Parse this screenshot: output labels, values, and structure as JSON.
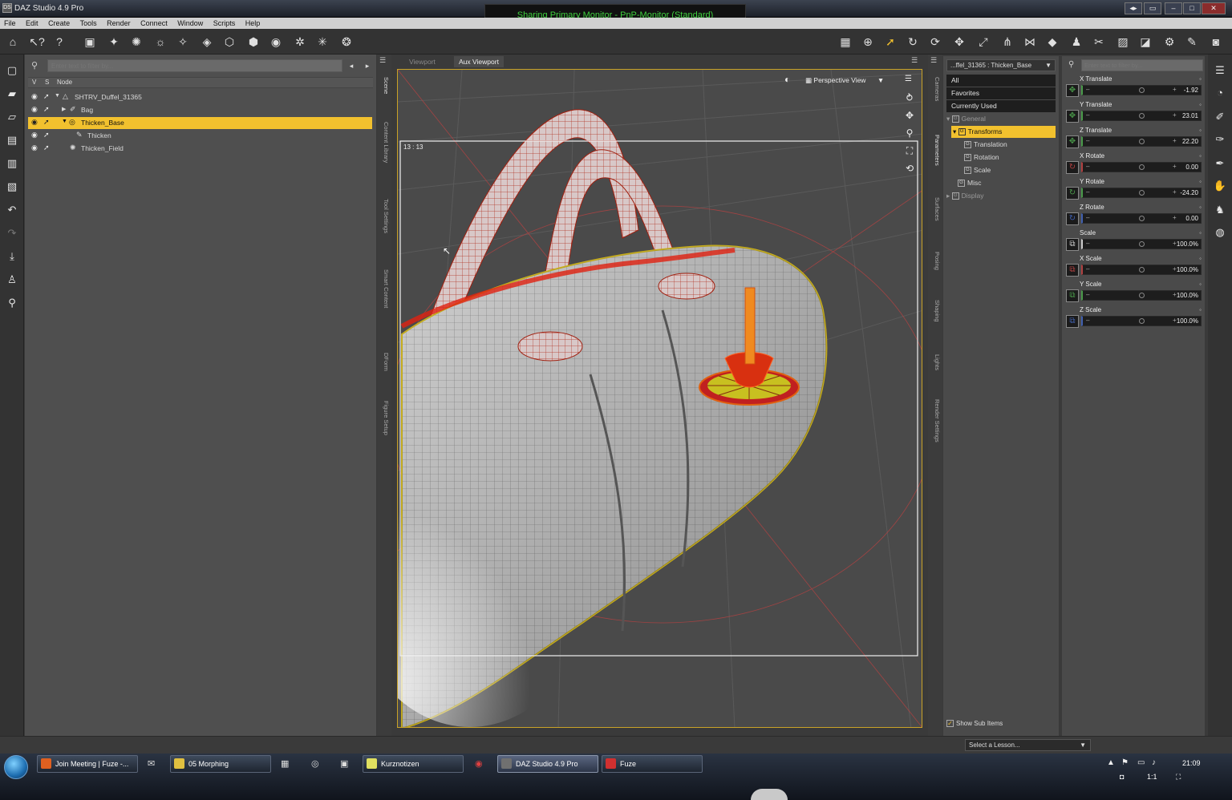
{
  "window": {
    "app_title": "DAZ Studio 4.9 Pro",
    "badge": "DS",
    "sharing_banner": "Sharing Primary Monitor - PnP-Monitor (Standard)"
  },
  "menu": [
    "File",
    "Edit",
    "Create",
    "Tools",
    "Render",
    "Connect",
    "Window",
    "Scripts",
    "Help"
  ],
  "scene": {
    "search_placeholder": "Enter text to filter by...",
    "col_v": "V",
    "col_s": "S",
    "col_node": "Node",
    "nodes": [
      {
        "name": "SHTRV_Duffel_31365"
      },
      {
        "name": "Bag"
      },
      {
        "name": "Thicken_Base"
      },
      {
        "name": "Thicken"
      },
      {
        "name": "Thicken_Field"
      }
    ]
  },
  "left_tabs": [
    "Scene",
    "Content Library",
    "Tool Settings",
    "Smart Content",
    "DForm",
    "Figure Setup"
  ],
  "viewport": {
    "tab1": "Viewport",
    "tab2": "Aux Viewport",
    "view_label": "Perspective View",
    "frame_label": "13 : 13"
  },
  "right_tabs": [
    "Cameras",
    "Parameters",
    "Surfaces",
    "Posing",
    "Shaping",
    "Lights",
    "Render Settings"
  ],
  "parameters": {
    "node_select": "...ffel_31365 : Thicken_Base",
    "search_placeholder": "Enter text to filter by...",
    "tree": {
      "all": "All",
      "favorites": "Favorites",
      "currently_used": "Currently Used",
      "general": "General",
      "transforms": "Transforms",
      "translation": "Translation",
      "rotation": "Rotation",
      "scale": "Scale",
      "misc": "Misc",
      "display": "Display"
    },
    "sliders": [
      {
        "label": "X Translate",
        "value": "-1.92",
        "level": 0.5,
        "accent": "#4a9a4a"
      },
      {
        "label": "Y Translate",
        "value": "23.01",
        "level": 0.5,
        "accent": "#4a9a4a"
      },
      {
        "label": "Z Translate",
        "value": "22.20",
        "level": 0.5,
        "accent": "#4a9a4a"
      },
      {
        "label": "X Rotate",
        "value": "0.00",
        "level": 0.5,
        "accent": "#b04040"
      },
      {
        "label": "Y Rotate",
        "value": "-24.20",
        "level": 0.5,
        "accent": "#4a9a4a"
      },
      {
        "label": "Z Rotate",
        "value": "0.00",
        "level": 0.5,
        "accent": "#4060b0"
      },
      {
        "label": "Scale",
        "value": "100.0%",
        "level": 0.5,
        "accent": "#cccccc"
      },
      {
        "label": "X Scale",
        "value": "100.0%",
        "level": 0.5,
        "accent": "#b04040"
      },
      {
        "label": "Y Scale",
        "value": "100.0%",
        "level": 0.5,
        "accent": "#4a9a4a"
      },
      {
        "label": "Z Scale",
        "value": "100.0%",
        "level": 0.5,
        "accent": "#4060b0"
      }
    ],
    "show_sub_items": "Show Sub Items"
  },
  "lesson_select": "Select a Lesson...",
  "taskbar": {
    "tasks": [
      {
        "label": "Join Meeting | Fuze -...",
        "color": "#e06020"
      },
      {
        "label": "05 Morphing",
        "color": "#e0c040"
      },
      {
        "label": "Kurznotizen",
        "color": "#e0e060"
      },
      {
        "label": "DAZ Studio 4.9 Pro",
        "color": "#707070"
      },
      {
        "label": "Fuze",
        "color": "#d03030"
      }
    ],
    "clock": "21:09",
    "zoom": "1:1"
  }
}
